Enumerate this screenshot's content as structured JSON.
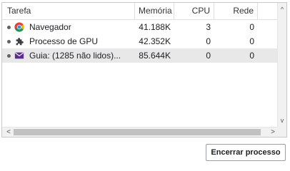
{
  "columns": {
    "task": "Tarefa",
    "memory": "Memória",
    "cpu": "CPU",
    "network": "Rede"
  },
  "rows": [
    {
      "icon": "chrome-icon",
      "name": "Navegador",
      "memory": "41.188K",
      "cpu": "3",
      "network": "0",
      "selected": false
    },
    {
      "icon": "puzzle-piece-icon",
      "name": "Processo de GPU",
      "memory": "42.352K",
      "cpu": "0",
      "network": "0",
      "selected": false
    },
    {
      "icon": "envelope-icon",
      "name": "Guia: (1285 não lidos)...",
      "memory": "85.644K",
      "cpu": "0",
      "network": "0",
      "selected": true
    }
  ],
  "colors": {
    "chrome_red": "#db4437",
    "chrome_yellow": "#f4b400",
    "chrome_green": "#0f9d58",
    "chrome_blue": "#4285f4",
    "envelope": "#5c2d91",
    "selected_row": "#e8e8e8"
  },
  "actions": {
    "end_process": "Encerrar processo"
  },
  "scrollbars": {
    "vertical_up": "^",
    "vertical_down": "v",
    "horizontal_left": "<",
    "horizontal_right": ">"
  }
}
